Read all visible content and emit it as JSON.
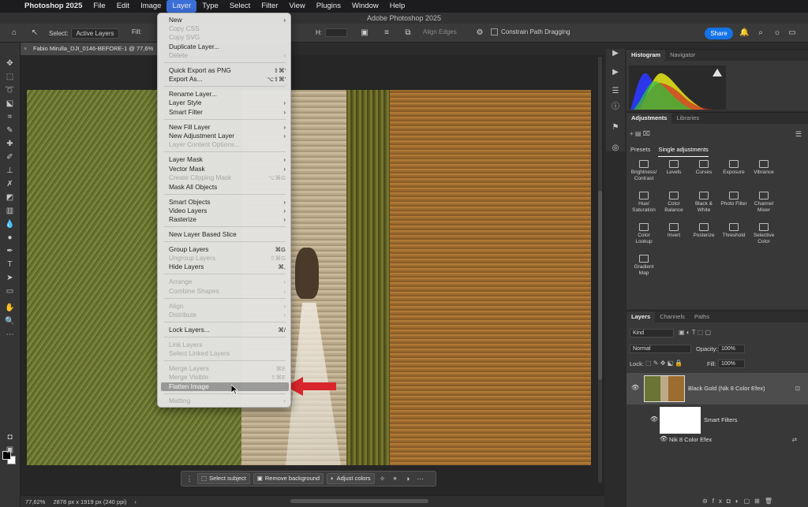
{
  "menubar": {
    "items": [
      "Photoshop 2025",
      "File",
      "Edit",
      "Image",
      "Layer",
      "Type",
      "Select",
      "Filter",
      "View",
      "Plugins",
      "Window",
      "Help"
    ],
    "active": "Layer"
  },
  "window": {
    "title": "Adobe Photoshop 2025"
  },
  "options": {
    "select_label": "Select:",
    "select_value": "Active Layers",
    "fill_label": "Fill:",
    "h_label": "H:",
    "align_edges": "Align Edges",
    "constrain": "Constrain Path Dragging",
    "share": "Share"
  },
  "document": {
    "tab_title": "Fabio Mirulla_DJI_0146-BEFORE-1 @ 77,6%",
    "zoom": "77,62%",
    "dims": "2878 px x 1919 px (240 ppi)"
  },
  "context_bar": {
    "select_subject": "Select subject",
    "remove_background": "Remove background",
    "adjust_colors": "Adjust colors"
  },
  "layer_menu": {
    "items": [
      {
        "label": "New",
        "sub": true,
        "enabled": true
      },
      {
        "label": "Copy CSS",
        "enabled": false
      },
      {
        "label": "Copy SVG",
        "enabled": false
      },
      {
        "label": "Duplicate Layer...",
        "enabled": true
      },
      {
        "label": "Delete",
        "sub": true,
        "enabled": false
      },
      {
        "label": "Quick Export as PNG",
        "shortcut": "⇧⌘'",
        "enabled": true
      },
      {
        "label": "Export As...",
        "shortcut": "⌥⇧⌘'",
        "enabled": true
      },
      {
        "label": "Rename Layer...",
        "enabled": true
      },
      {
        "label": "Layer Style",
        "sub": true,
        "enabled": true
      },
      {
        "label": "Smart Filter",
        "sub": true,
        "enabled": true
      },
      {
        "label": "New Fill Layer",
        "sub": true,
        "enabled": true
      },
      {
        "label": "New Adjustment Layer",
        "sub": true,
        "enabled": true
      },
      {
        "label": "Layer Content Options...",
        "enabled": false
      },
      {
        "label": "Layer Mask",
        "sub": true,
        "enabled": true
      },
      {
        "label": "Vector Mask",
        "sub": true,
        "enabled": true
      },
      {
        "label": "Create Clipping Mask",
        "shortcut": "⌥⌘G",
        "enabled": false
      },
      {
        "label": "Mask All Objects",
        "enabled": true
      },
      {
        "label": "Smart Objects",
        "sub": true,
        "enabled": true
      },
      {
        "label": "Video Layers",
        "sub": true,
        "enabled": true
      },
      {
        "label": "Rasterize",
        "sub": true,
        "enabled": true
      },
      {
        "label": "New Layer Based Slice",
        "enabled": true
      },
      {
        "label": "Group Layers",
        "shortcut": "⌘G",
        "enabled": true
      },
      {
        "label": "Ungroup Layers",
        "shortcut": "⇧⌘G",
        "enabled": false
      },
      {
        "label": "Hide Layers",
        "shortcut": "⌘,",
        "enabled": true
      },
      {
        "label": "Arrange",
        "sub": true,
        "enabled": false
      },
      {
        "label": "Combine Shapes",
        "sub": true,
        "enabled": false
      },
      {
        "label": "Align",
        "sub": true,
        "enabled": false
      },
      {
        "label": "Distribute",
        "sub": true,
        "enabled": false
      },
      {
        "label": "Lock Layers...",
        "shortcut": "⌘/",
        "enabled": true
      },
      {
        "label": "Link Layers",
        "enabled": false
      },
      {
        "label": "Select Linked Layers",
        "enabled": false
      },
      {
        "label": "Merge Layers",
        "shortcut": "⌘E",
        "enabled": false
      },
      {
        "label": "Merge Visible",
        "shortcut": "⇧⌘E",
        "enabled": false
      },
      {
        "label": "Flatten Image",
        "enabled": true,
        "highlighted": true
      },
      {
        "label": "Matting",
        "sub": true,
        "enabled": false
      }
    ]
  },
  "panels": {
    "histogram_tabs": [
      "Histogram",
      "Navigator"
    ],
    "adjustments_tabs": [
      "Adjustments",
      "Libraries"
    ],
    "adjust_subtabs": [
      "Presets",
      "Single adjustments"
    ],
    "adjust_items": [
      "Brightness/\nContrast",
      "Levels",
      "Curves",
      "Exposure",
      "Vibrance",
      "Hue/\nSaturation",
      "Color\nBalance",
      "Black &\nWhite",
      "Photo Filter",
      "Channel\nMixer",
      "Color\nLookup",
      "Invert",
      "Posterize",
      "Threshold",
      "Selective\nColor",
      "Gradient\nMap"
    ],
    "layers_tabs": [
      "Layers",
      "Channels",
      "Paths"
    ],
    "kind": "Kind",
    "blend": "Normal",
    "opacity_label": "Opacity:",
    "opacity": "100%",
    "lock_label": "Lock:",
    "fill_label": "Fill:",
    "fill": "100%",
    "layer_name": "Black Gold (Nik 8 Color Efex)",
    "smart_filters": "Smart Filters",
    "filter_name": "Nik 8 Color Efex"
  },
  "colors": {
    "accent": "#1473e6",
    "arrow": "#d9262c",
    "menu_bg": "#e4e4e2"
  }
}
